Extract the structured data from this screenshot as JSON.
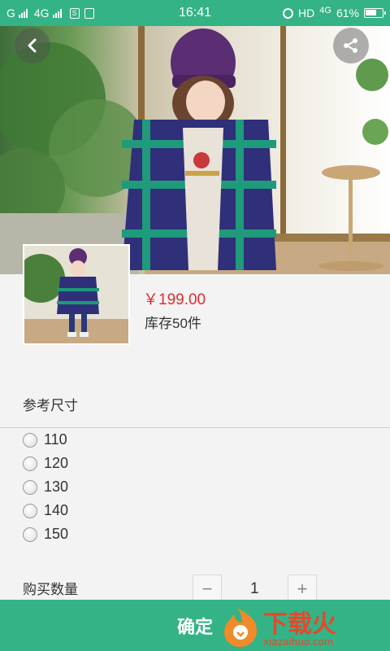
{
  "status_bar": {
    "carrier_left": "G",
    "network_type": "4G",
    "sim_label": "S",
    "time": "16:41",
    "hd_label": "HD",
    "network_right": "4G",
    "battery_percent": "61%"
  },
  "hero": {
    "back_icon": "chevron-left-icon",
    "share_icon": "share-icon"
  },
  "product": {
    "price": "￥199.00",
    "stock": "库存50件"
  },
  "size_section": {
    "title": "参考尺寸",
    "options": [
      "110",
      "120",
      "130",
      "140",
      "150"
    ]
  },
  "quantity_section": {
    "title": "购买数量",
    "minus_label": "−",
    "value": "1",
    "plus_label": "+"
  },
  "footer": {
    "confirm_label": "确定",
    "watermark_text": "下载火",
    "watermark_url": "xiazaihuo.com"
  },
  "colors": {
    "accent": "#34b386",
    "price": "#e02b2b"
  }
}
